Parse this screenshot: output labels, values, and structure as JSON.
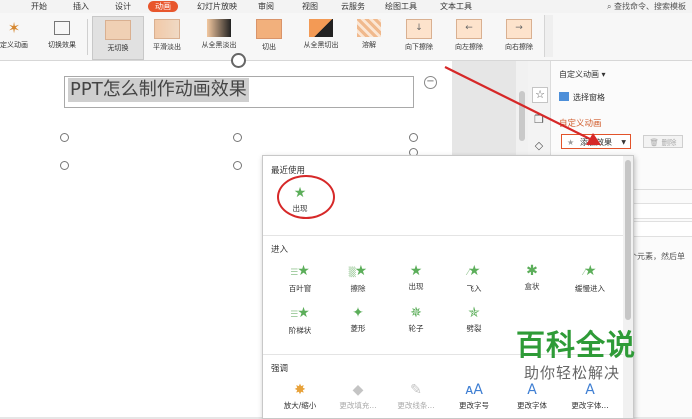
{
  "menubar": {
    "items": [
      "开始",
      "插入",
      "设计",
      "动画",
      "幻灯片放映",
      "审阅",
      "视图",
      "云服务",
      "绘图工具",
      "文本工具"
    ],
    "active_index": 3,
    "search": "查找命令、搜索模板"
  },
  "ribbon": {
    "custom_anim": "定义动画",
    "switch_effect": "切换效果",
    "transitions": [
      "无切换",
      "平滑淡出",
      "从全黑淡出",
      "切出",
      "从全黑切出",
      "溶解",
      "向下擦除",
      "向左擦除",
      "向右擦除"
    ]
  },
  "slide": {
    "text": "PPT怎么制作动画效果"
  },
  "panel": {
    "title": "自定义动画",
    "select_pane": "选择窗格",
    "heading": "自定义动画",
    "add_effect": "添加效果",
    "delete": "删除",
    "hint": "个元素，然后单"
  },
  "dropdown": {
    "recent": {
      "title": "最近使用",
      "items": [
        "出现"
      ]
    },
    "enter": {
      "title": "进入",
      "items": [
        "百叶窗",
        "擦除",
        "出现",
        "飞入",
        "盒状",
        "缓慢进入",
        "阶梯状",
        "菱形",
        "轮子",
        "劈裂"
      ]
    },
    "emphasis": {
      "title": "强调",
      "items": [
        "放大/缩小",
        "更改填充...",
        "更改线条...",
        "更改字号",
        "更改字体",
        "更改字体..."
      ]
    }
  },
  "watermark": {
    "title": "百科全说",
    "subtitle": "助你轻松解决"
  },
  "colors": {
    "accent": "#e8562c",
    "star_green": "#5cae5a",
    "annotation_red": "#d62828",
    "watermark_green": "#2e9b37"
  }
}
